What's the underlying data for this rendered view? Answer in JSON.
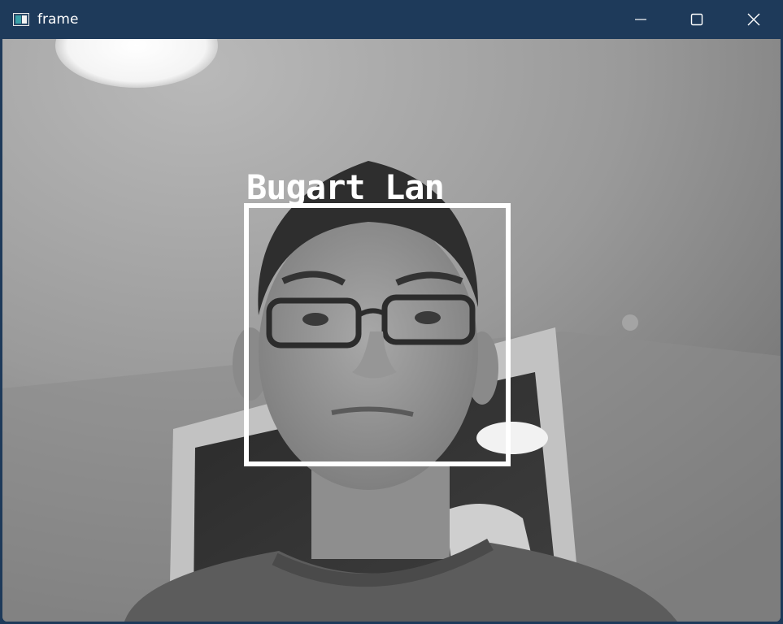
{
  "window": {
    "title": "frame",
    "icon": "app-window-icon",
    "controls": {
      "minimize_icon": "minimize-icon",
      "maximize_icon": "maximize-icon",
      "close_icon": "close-icon"
    },
    "titlebar_color": "#1e3a5a"
  },
  "video": {
    "detection_label": "Bugart Lan",
    "box_color": "#ffffff",
    "content": "grayscale webcam frame"
  }
}
